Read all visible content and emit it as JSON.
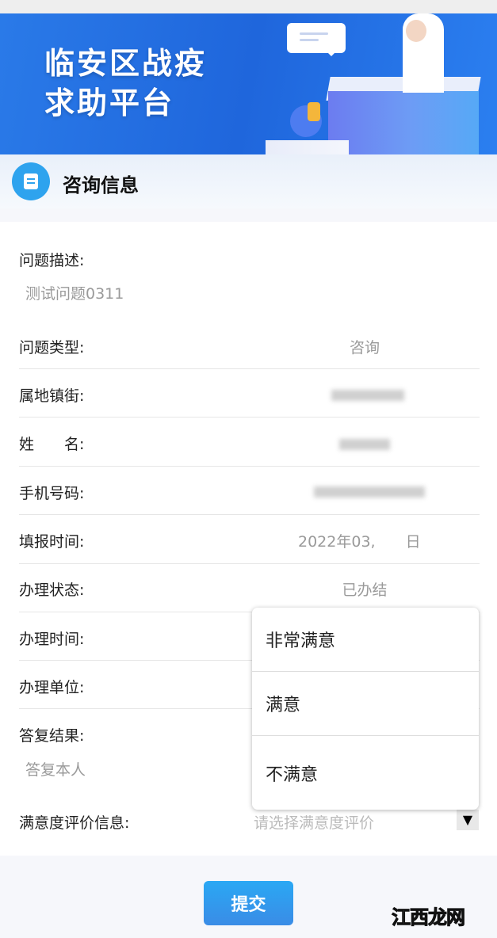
{
  "banner": {
    "title_line1": "临安区战疫",
    "title_line2": "求助平台"
  },
  "section": {
    "title": "咨询信息",
    "icon": "message-icon"
  },
  "form": {
    "description": {
      "label": "问题描述:",
      "value": "测试问题0311"
    },
    "type": {
      "label": "问题类型:",
      "value": "咨询"
    },
    "street": {
      "label": "属地镇街:"
    },
    "name": {
      "label": "姓　　名:"
    },
    "phone": {
      "label": "手机号码:"
    },
    "report_time": {
      "label": "填报时间:",
      "value_prefix": "2022年03,",
      "value_suffix": "日"
    },
    "status": {
      "label": "办理状态:",
      "value": "已办结"
    },
    "handle_time": {
      "label": "办理时间:"
    },
    "handle_unit": {
      "label": "办理单位:"
    },
    "reply": {
      "label": "答复结果:",
      "value": "答复本人"
    },
    "satisfaction": {
      "label": "满意度评价信息:",
      "placeholder": "请选择满意度评价",
      "options": [
        "非常满意",
        "满意",
        "不满意"
      ]
    }
  },
  "submit_label": "提交",
  "watermark": "江西龙网"
}
